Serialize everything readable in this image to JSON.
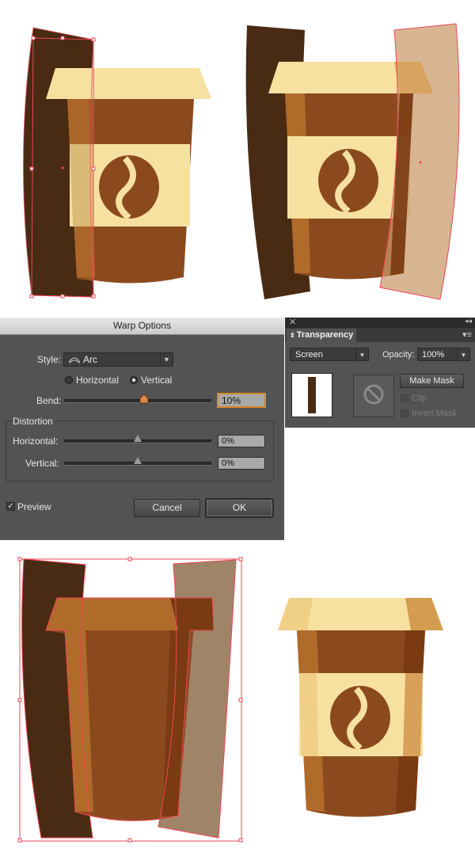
{
  "warp_options": {
    "title": "Warp Options",
    "style_label": "Style:",
    "style_value": "Arc",
    "horizontal_label": "Horizontal",
    "vertical_label": "Vertical",
    "orientation_selected": "Vertical",
    "bend_label": "Bend:",
    "bend_value": "10%",
    "bend_percent": 10,
    "distortion_label": "Distortion",
    "distortion_horizontal_label": "Horizontal:",
    "distortion_horizontal_value": "0%",
    "distortion_vertical_label": "Vertical:",
    "distortion_vertical_value": "0%",
    "preview_label": "Preview",
    "preview_checked": true,
    "cancel_label": "Cancel",
    "ok_label": "OK"
  },
  "transparency_panel": {
    "tab_label": "Transparency",
    "blend_mode": "Screen",
    "opacity_label": "Opacity:",
    "opacity_value": "100%",
    "make_mask_label": "Make Mask",
    "clip_label": "Clip",
    "invert_mask_label": "Invert Mask"
  },
  "colors": {
    "dark_brown": "#482b12",
    "cup_brown": "#8b4a1e",
    "cup_mid": "#b5702f",
    "cream": "#f7e1a1",
    "lid_tan": "#d49c4f",
    "shadow_brown": "#7a3a12",
    "selection_red": "#ee4455",
    "panel_gray": "#535353"
  },
  "icons": [
    "coffee-bean-icon",
    "arc-warp-icon",
    "no-mask-icon",
    "close-icon",
    "collapse-icon",
    "panel-menu-icon"
  ]
}
